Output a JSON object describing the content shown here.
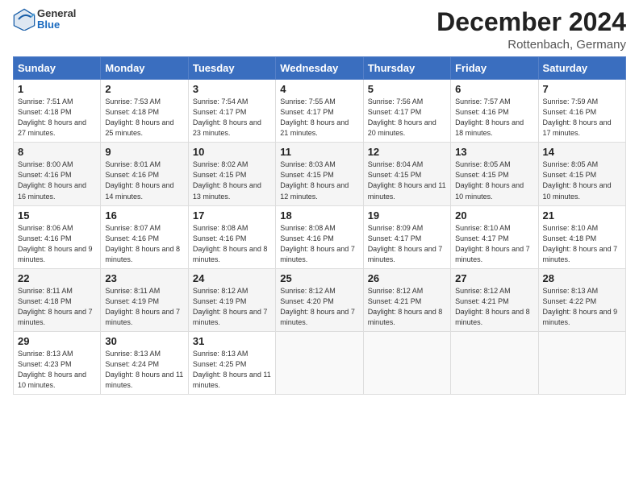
{
  "header": {
    "logo_general": "General",
    "logo_blue": "Blue",
    "title": "December 2024",
    "subtitle": "Rottenbach, Germany"
  },
  "calendar": {
    "days_of_week": [
      "Sunday",
      "Monday",
      "Tuesday",
      "Wednesday",
      "Thursday",
      "Friday",
      "Saturday"
    ],
    "weeks": [
      [
        null,
        {
          "day": 2,
          "sunrise": "7:53 AM",
          "sunset": "4:18 PM",
          "daylight": "8 hours and 25 minutes."
        },
        {
          "day": 3,
          "sunrise": "7:54 AM",
          "sunset": "4:17 PM",
          "daylight": "8 hours and 23 minutes."
        },
        {
          "day": 4,
          "sunrise": "7:55 AM",
          "sunset": "4:17 PM",
          "daylight": "8 hours and 21 minutes."
        },
        {
          "day": 5,
          "sunrise": "7:56 AM",
          "sunset": "4:17 PM",
          "daylight": "8 hours and 20 minutes."
        },
        {
          "day": 6,
          "sunrise": "7:57 AM",
          "sunset": "4:16 PM",
          "daylight": "8 hours and 18 minutes."
        },
        {
          "day": 7,
          "sunrise": "7:59 AM",
          "sunset": "4:16 PM",
          "daylight": "8 hours and 17 minutes."
        }
      ],
      [
        {
          "day": 8,
          "sunrise": "8:00 AM",
          "sunset": "4:16 PM",
          "daylight": "8 hours and 16 minutes."
        },
        {
          "day": 9,
          "sunrise": "8:01 AM",
          "sunset": "4:16 PM",
          "daylight": "8 hours and 14 minutes."
        },
        {
          "day": 10,
          "sunrise": "8:02 AM",
          "sunset": "4:15 PM",
          "daylight": "8 hours and 13 minutes."
        },
        {
          "day": 11,
          "sunrise": "8:03 AM",
          "sunset": "4:15 PM",
          "daylight": "8 hours and 12 minutes."
        },
        {
          "day": 12,
          "sunrise": "8:04 AM",
          "sunset": "4:15 PM",
          "daylight": "8 hours and 11 minutes."
        },
        {
          "day": 13,
          "sunrise": "8:05 AM",
          "sunset": "4:15 PM",
          "daylight": "8 hours and 10 minutes."
        },
        {
          "day": 14,
          "sunrise": "8:05 AM",
          "sunset": "4:15 PM",
          "daylight": "8 hours and 10 minutes."
        }
      ],
      [
        {
          "day": 15,
          "sunrise": "8:06 AM",
          "sunset": "4:16 PM",
          "daylight": "8 hours and 9 minutes."
        },
        {
          "day": 16,
          "sunrise": "8:07 AM",
          "sunset": "4:16 PM",
          "daylight": "8 hours and 8 minutes."
        },
        {
          "day": 17,
          "sunrise": "8:08 AM",
          "sunset": "4:16 PM",
          "daylight": "8 hours and 8 minutes."
        },
        {
          "day": 18,
          "sunrise": "8:08 AM",
          "sunset": "4:16 PM",
          "daylight": "8 hours and 7 minutes."
        },
        {
          "day": 19,
          "sunrise": "8:09 AM",
          "sunset": "4:17 PM",
          "daylight": "8 hours and 7 minutes."
        },
        {
          "day": 20,
          "sunrise": "8:10 AM",
          "sunset": "4:17 PM",
          "daylight": "8 hours and 7 minutes."
        },
        {
          "day": 21,
          "sunrise": "8:10 AM",
          "sunset": "4:18 PM",
          "daylight": "8 hours and 7 minutes."
        }
      ],
      [
        {
          "day": 22,
          "sunrise": "8:11 AM",
          "sunset": "4:18 PM",
          "daylight": "8 hours and 7 minutes."
        },
        {
          "day": 23,
          "sunrise": "8:11 AM",
          "sunset": "4:19 PM",
          "daylight": "8 hours and 7 minutes."
        },
        {
          "day": 24,
          "sunrise": "8:12 AM",
          "sunset": "4:19 PM",
          "daylight": "8 hours and 7 minutes."
        },
        {
          "day": 25,
          "sunrise": "8:12 AM",
          "sunset": "4:20 PM",
          "daylight": "8 hours and 7 minutes."
        },
        {
          "day": 26,
          "sunrise": "8:12 AM",
          "sunset": "4:21 PM",
          "daylight": "8 hours and 8 minutes."
        },
        {
          "day": 27,
          "sunrise": "8:12 AM",
          "sunset": "4:21 PM",
          "daylight": "8 hours and 8 minutes."
        },
        {
          "day": 28,
          "sunrise": "8:13 AM",
          "sunset": "4:22 PM",
          "daylight": "8 hours and 9 minutes."
        }
      ],
      [
        {
          "day": 29,
          "sunrise": "8:13 AM",
          "sunset": "4:23 PM",
          "daylight": "8 hours and 10 minutes."
        },
        {
          "day": 30,
          "sunrise": "8:13 AM",
          "sunset": "4:24 PM",
          "daylight": "8 hours and 11 minutes."
        },
        {
          "day": 31,
          "sunrise": "8:13 AM",
          "sunset": "4:25 PM",
          "daylight": "8 hours and 11 minutes."
        },
        null,
        null,
        null,
        null
      ]
    ],
    "week1_day1": {
      "day": 1,
      "sunrise": "7:51 AM",
      "sunset": "4:18 PM",
      "daylight": "8 hours and 27 minutes."
    }
  }
}
